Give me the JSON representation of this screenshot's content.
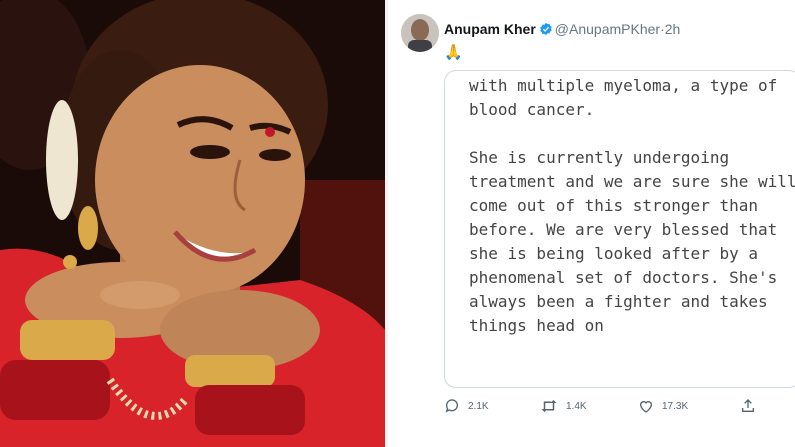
{
  "photo": {
    "subject": "woman smiling with hands clasped under chin",
    "colors": {
      "background": "#1a0a08",
      "saree": "#d8232a",
      "bangles": "#a8121b",
      "gold": "#d9a94a",
      "skin": "#c98d5e",
      "hair": "#3a1c10"
    }
  },
  "tweet": {
    "author_name": "Anupam Kher",
    "handle": "@AnupamPKher",
    "separator": "·",
    "time": "2h",
    "emoji": "🙏",
    "card_text": "with multiple myeloma, a type of\nblood cancer.\n\nShe is currently undergoing\ntreatment and we are sure she will\ncome out of this stronger than\nbefore. We are very blessed that\nshe is being looked after by a\nphenomenal set of doctors. She's\nalways been a fighter and takes\nthings head on",
    "actions": {
      "reply_count": "2.1K",
      "retweet_count": "1.4K",
      "like_count": "17.3K"
    }
  },
  "colors": {
    "verified": "#1d9bf0",
    "muted": "#657786",
    "text": "#14171a",
    "border": "#cfd9de"
  },
  "icons": [
    "verified-icon",
    "reply-icon",
    "retweet-icon",
    "like-icon",
    "share-icon"
  ]
}
